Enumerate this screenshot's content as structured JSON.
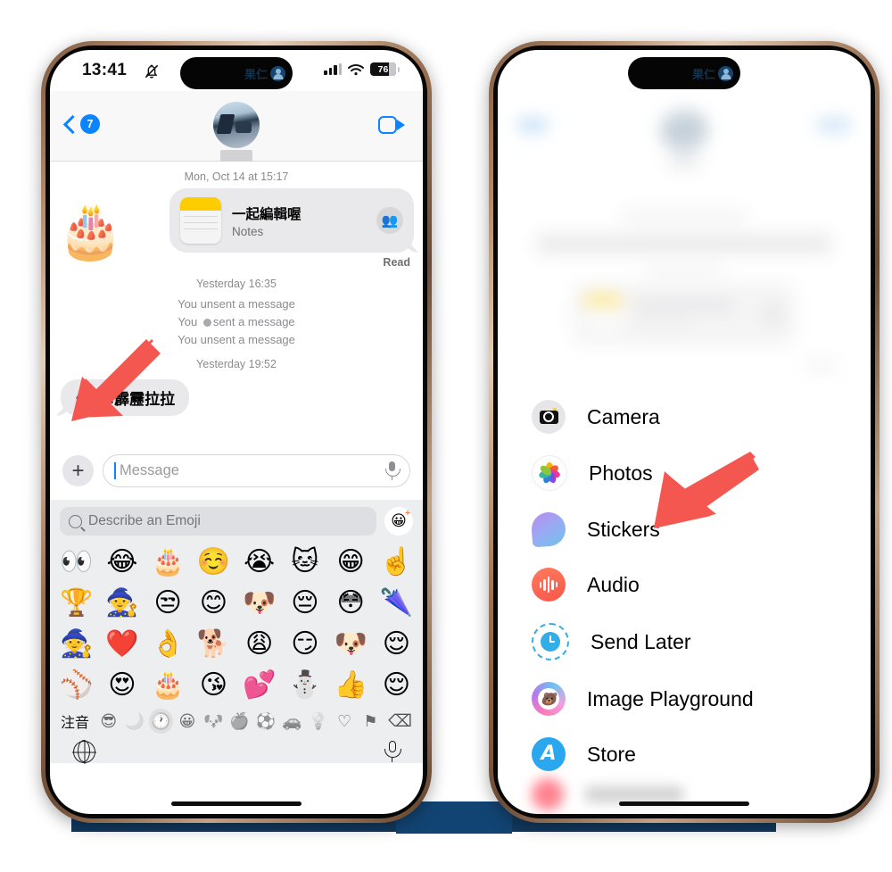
{
  "background": {
    "navy": "#12395e",
    "page": "#ffffff"
  },
  "left_phone": {
    "status_bar": {
      "time": "13:41",
      "silent_icon": "bell-slash-icon",
      "signal_icon": "cellular-bars-icon",
      "wifi_icon": "wifi-icon",
      "battery_percent": "76"
    },
    "dynamic_island": {
      "text": "果仁",
      "avatar_icon": "contact-avatar-icon"
    },
    "nav_bar": {
      "back_icon": "chevron-left-icon",
      "unread_badge": "7",
      "contact_name_redacted": true,
      "facetime_icon": "video-camera-icon"
    },
    "conversation": {
      "date_divider": "Mon, Oct 14 at 15:17",
      "notes_card": {
        "title": "一起編輯喔",
        "app": "Notes",
        "collaborators_icon": "people-icon"
      },
      "delivery_status": "Read",
      "cake_sticker": "🎂",
      "timestamp_1": "Yesterday 16:35",
      "system_lines": [
        "You unsent a message",
        "You ● sent a message",
        "You unsent a message"
      ],
      "timestamp_2": "Yesterday 19:52",
      "incoming_bubble": "🧙 卡霹靂拉拉"
    },
    "composer": {
      "plus_label": "+",
      "message_placeholder": "Message",
      "mic_icon": "microphone-icon"
    },
    "emoji_keyboard": {
      "search_placeholder": "Describe an Emoji",
      "search_icon": "search-icon",
      "genmoji_icon": "emoji-plus-icon",
      "emoji_rows": [
        [
          "👀",
          "😂",
          "🎂",
          "☺️",
          "😭",
          "🐱",
          "😁",
          "☝️"
        ],
        [
          "🏆",
          "🧙",
          "😒",
          "😊",
          "🐶",
          "😔",
          "😳",
          "🌂"
        ],
        [
          "🧙",
          "❤️",
          "👌",
          "🐕",
          "😩",
          "😏",
          "🐶",
          "😌"
        ],
        [
          "⚾",
          "😍",
          "🎂",
          "😘",
          "💕",
          "⛄",
          "👍",
          "😌"
        ]
      ],
      "category_bar": {
        "input_mode": "注音",
        "categories": [
          "😎",
          "🌙",
          "🕐",
          "😀",
          "🐶",
          "🍎",
          "⚽",
          "🚗",
          "💡",
          "♡",
          "⚑"
        ],
        "selected_index": 2,
        "delete_icon": "backspace-icon"
      },
      "globe_icon": "globe-icon",
      "dictation_icon": "microphone-icon"
    },
    "arrow_annotation": {
      "color": "#f4574f",
      "points_to": "incoming-message-bubble"
    }
  },
  "right_phone": {
    "dynamic_island": {
      "text": "果仁",
      "avatar_icon": "contact-avatar-icon"
    },
    "app_menu": {
      "items": [
        {
          "label": "Camera",
          "icon": "camera-icon"
        },
        {
          "label": "Photos",
          "icon": "photos-icon"
        },
        {
          "label": "Stickers",
          "icon": "stickers-icon"
        },
        {
          "label": "Audio",
          "icon": "audio-icon"
        },
        {
          "label": "Send Later",
          "icon": "send-later-clock-icon"
        },
        {
          "label": "Image Playground",
          "icon": "image-playground-icon"
        },
        {
          "label": "Store",
          "icon": "app-store-icon"
        }
      ]
    },
    "arrow_annotation": {
      "color": "#f4574f",
      "points_to": "stickers-menu-item"
    }
  }
}
